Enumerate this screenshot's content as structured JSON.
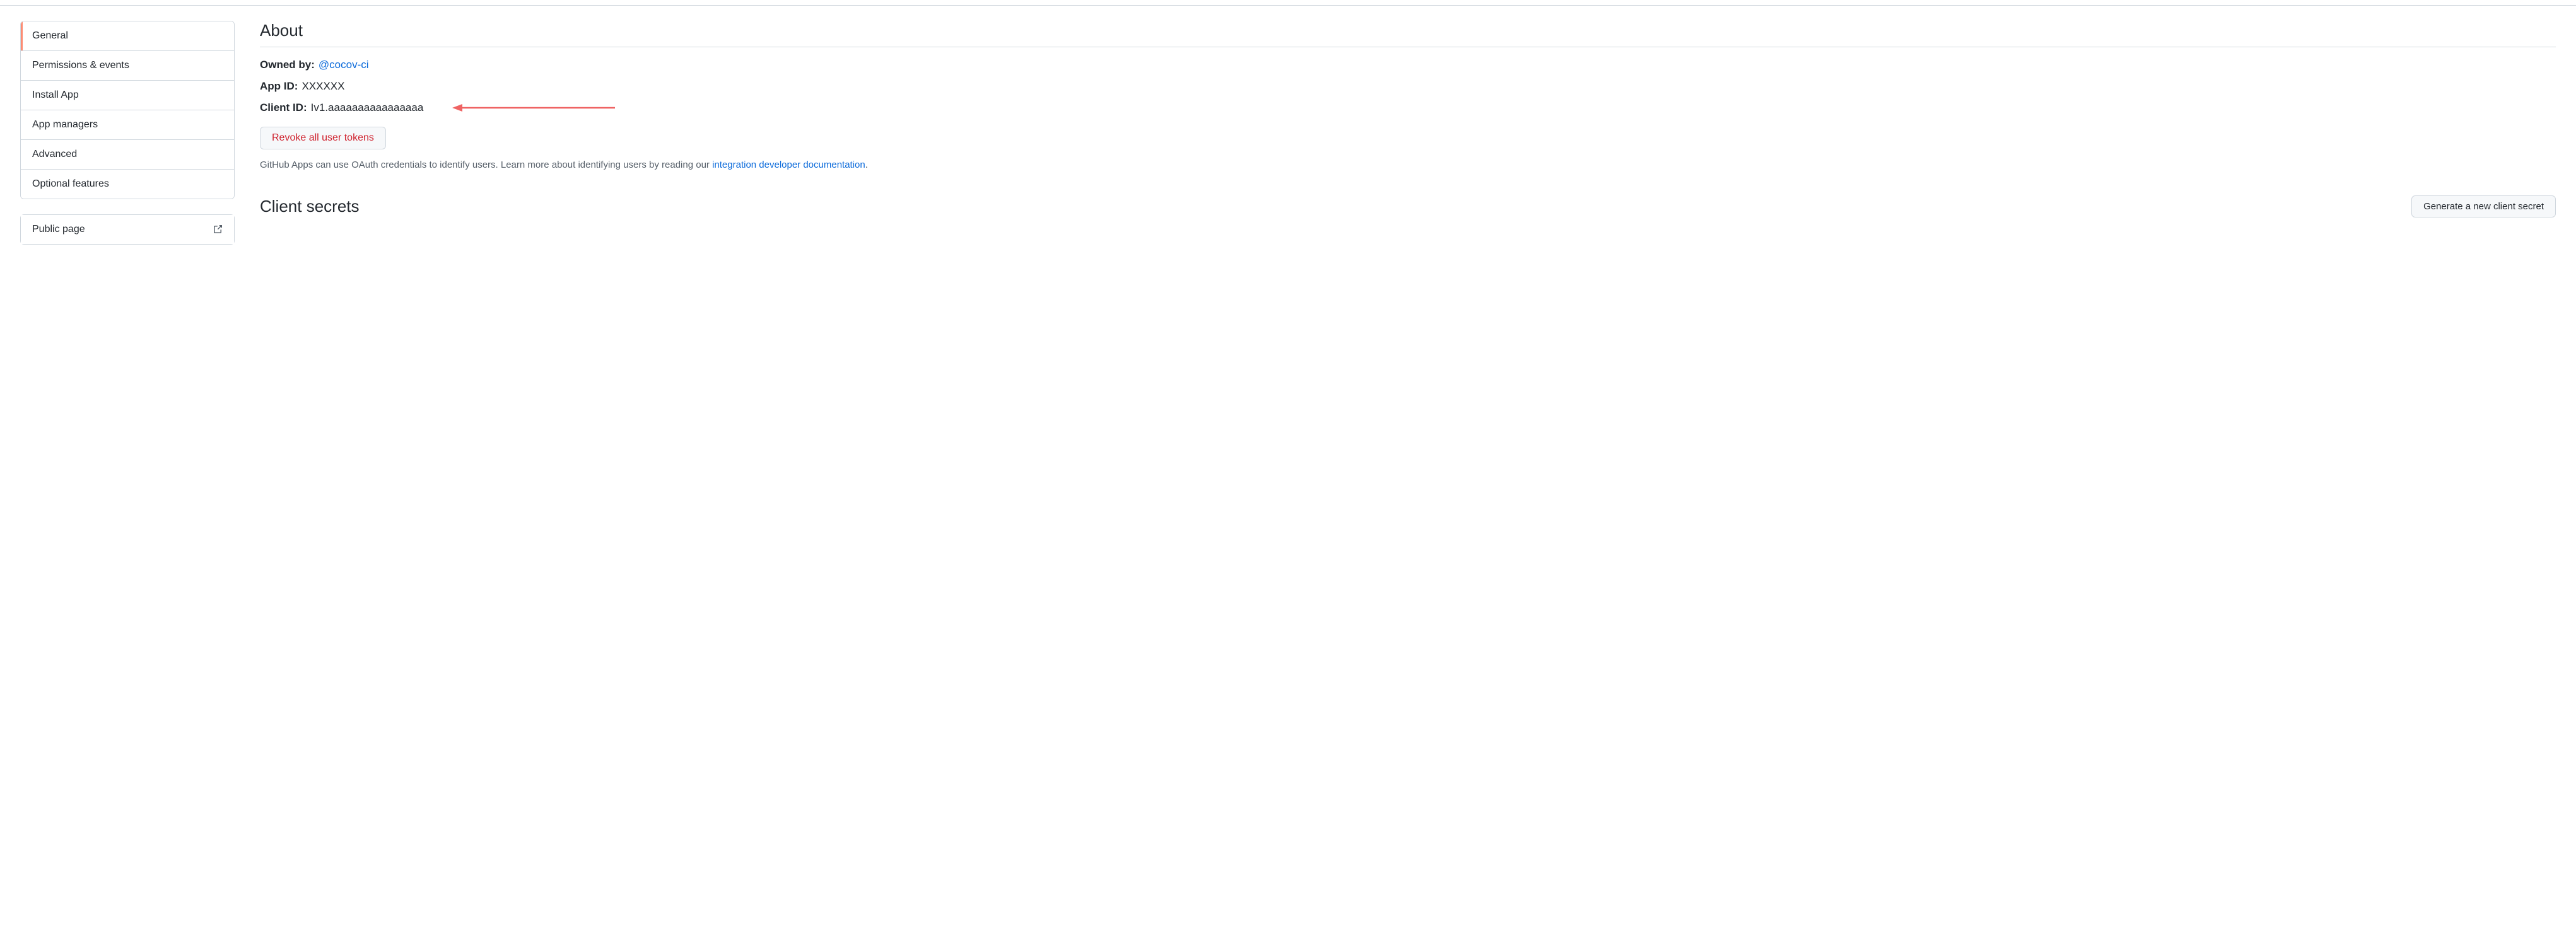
{
  "sidebar": {
    "items": [
      {
        "label": "General",
        "active": true
      },
      {
        "label": "Permissions & events",
        "active": false
      },
      {
        "label": "Install App",
        "active": false
      },
      {
        "label": "App managers",
        "active": false
      },
      {
        "label": "Advanced",
        "active": false
      },
      {
        "label": "Optional features",
        "active": false
      }
    ],
    "public_page": "Public page"
  },
  "about": {
    "title": "About",
    "owned_by_label": "Owned by:",
    "owner": "@cocov-ci",
    "app_id_label": "App ID:",
    "app_id_value": "XXXXXX",
    "client_id_label": "Client ID:",
    "client_id_value": "Iv1.aaaaaaaaaaaaaaaa",
    "revoke_button": "Revoke all user tokens",
    "help_text_prefix": "GitHub Apps can use OAuth credentials to identify users. Learn more about identifying users by reading our ",
    "help_link_text": "integration developer documentation",
    "help_text_suffix": "."
  },
  "secrets": {
    "title": "Client secrets",
    "generate_button": "Generate a new client secret"
  },
  "colors": {
    "link": "#0969da",
    "danger": "#cf222e",
    "annotation_arrow": "#ef6363"
  }
}
